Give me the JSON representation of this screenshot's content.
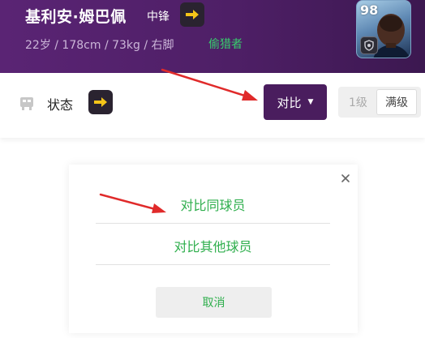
{
  "player": {
    "name": "基利安·姆巴佩",
    "position": "中锋",
    "stats": "22岁 / 178cm / 73kg / 右脚",
    "tag": "偷猎者",
    "rating": "98"
  },
  "status_bar": {
    "label": "状态",
    "compare_label": "对比",
    "level_label": "1级",
    "max_level_label": "满级"
  },
  "dialog": {
    "close_symbol": "×",
    "option_same_player": "对比同球员",
    "option_other_player": "对比其他球员",
    "cancel_label": "取消"
  },
  "colors": {
    "header_bg": "#4e1f66",
    "compare_button_bg": "#4a1d5e",
    "tag_green": "#37d06d",
    "option_green": "#2eae4c",
    "annotation_red": "#e02a2a"
  },
  "icons": [
    "right-arrow-icon",
    "player-card-icon",
    "status-icon",
    "caret-down-icon",
    "close-icon",
    "annotation-arrow-icon"
  ]
}
